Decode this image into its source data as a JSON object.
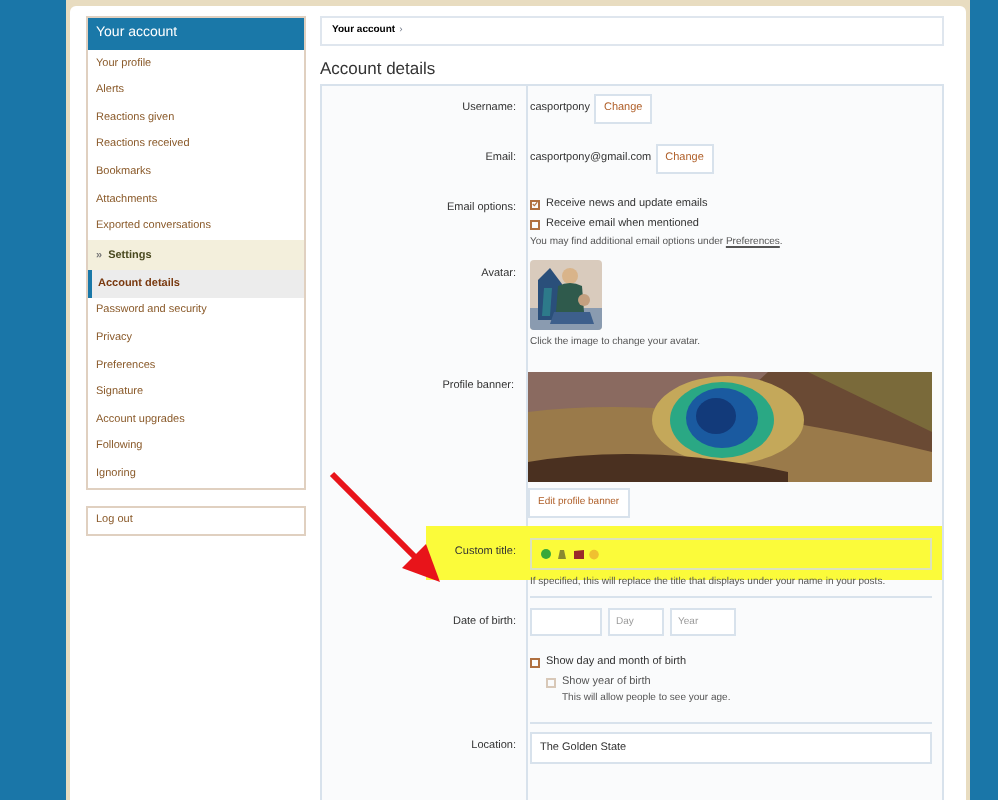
{
  "sidebar": {
    "title": "Your account",
    "items": [
      {
        "label": "Your profile",
        "kind": "link",
        "selected": false
      },
      {
        "label": "Alerts",
        "kind": "link",
        "selected": false
      },
      {
        "label": "Reactions given",
        "kind": "link",
        "selected": false
      },
      {
        "label": "Reactions received",
        "kind": "link",
        "selected": false
      },
      {
        "label": "Bookmarks",
        "kind": "link",
        "selected": false
      },
      {
        "label": "Attachments",
        "kind": "link",
        "selected": false
      },
      {
        "label": "Exported conversations",
        "kind": "link",
        "selected": false
      },
      {
        "label": "Settings",
        "kind": "section",
        "icon": "»",
        "selected": false
      },
      {
        "label": "Account details",
        "kind": "link",
        "selected": true
      },
      {
        "label": "Password and security",
        "kind": "link",
        "selected": false
      },
      {
        "label": "Privacy",
        "kind": "link",
        "selected": false
      },
      {
        "label": "Preferences",
        "kind": "link",
        "selected": false
      },
      {
        "label": "Signature",
        "kind": "link",
        "selected": false
      },
      {
        "label": "Account upgrades",
        "kind": "link",
        "selected": false
      },
      {
        "label": "Following",
        "kind": "link",
        "selected": false
      },
      {
        "label": "Ignoring",
        "kind": "link",
        "selected": false
      }
    ],
    "logout": "Log out"
  },
  "breadcrumb": {
    "label": "Your account",
    "separator": "›"
  },
  "heading": "Account details",
  "form": {
    "username": {
      "label": "Username:",
      "value": "casportpony",
      "button": "Change"
    },
    "email": {
      "label": "Email:",
      "value": "casportpony@gmail.com",
      "button": "Change"
    },
    "email_options": {
      "label": "Email options:",
      "options": [
        {
          "label": "Receive news and update emails",
          "checked": true
        },
        {
          "label": "Receive email when mentioned",
          "checked": false
        }
      ],
      "note": "You may find additional email options under **Preferences**."
    },
    "avatar": {
      "label": "Avatar:",
      "hint": "Click the image to change your avatar."
    },
    "banner": {
      "label": "Profile banner:",
      "button": "Edit profile banner"
    },
    "custom_title": {
      "label": "Custom title:",
      "hint": "If specified, this will replace the title that displays under your name in your posts."
    },
    "dob": {
      "label": "Date of birth:",
      "day_placeholder": "Day",
      "year_placeholder": "Year",
      "options": [
        {
          "label": "Show day and month of birth",
          "checked": false,
          "disabled": false
        },
        {
          "label": "Show year of birth",
          "checked": false,
          "disabled": true,
          "hint": "This will allow people to see your age."
        }
      ]
    },
    "location": {
      "label": "Location:",
      "value": "The Golden State"
    }
  }
}
